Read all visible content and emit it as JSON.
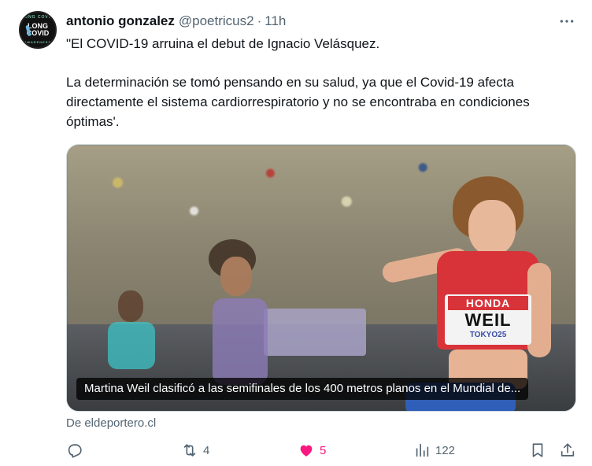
{
  "author": {
    "name": "antonio gonzalez",
    "handle": "@poetricus2",
    "separator": "·",
    "time": "11h",
    "avatar": {
      "line1": "LONG",
      "line2": "COVID",
      "ring_top": "LONG COVID",
      "ring_bottom": "AWARENESS"
    }
  },
  "more_icon": "more-horizontal-icon",
  "tweet": {
    "paragraphs": [
      "\"El COVID-19 arruina el debut de Ignacio Velásquez.",
      "La determinación se tomó pensando en su salud, ya que el Covid-19 afecta directamente el sistema cardiorrespiratorio y no se encontraba en condiciones óptimas'."
    ]
  },
  "media": {
    "caption": "Martina Weil clasificó a las semifinales de los 400 metros planos en el Mundial de...",
    "bib": {
      "sponsor": "HONDA",
      "name": "WEIL",
      "event": "TOKYO25"
    }
  },
  "source": "De eldeportero.cl",
  "actions": {
    "reply": {
      "icon": "reply-icon",
      "count": ""
    },
    "retweet": {
      "icon": "retweet-icon",
      "count": "4"
    },
    "like": {
      "icon": "heart-icon",
      "count": "5",
      "color": "#f91880"
    },
    "views": {
      "icon": "views-icon",
      "count": "122"
    },
    "bookmark": {
      "icon": "bookmark-icon"
    },
    "share": {
      "icon": "share-icon"
    }
  },
  "colors": {
    "text": "#0f1419",
    "secondary": "#536471",
    "like": "#f91880",
    "border": "#cfd9de"
  }
}
